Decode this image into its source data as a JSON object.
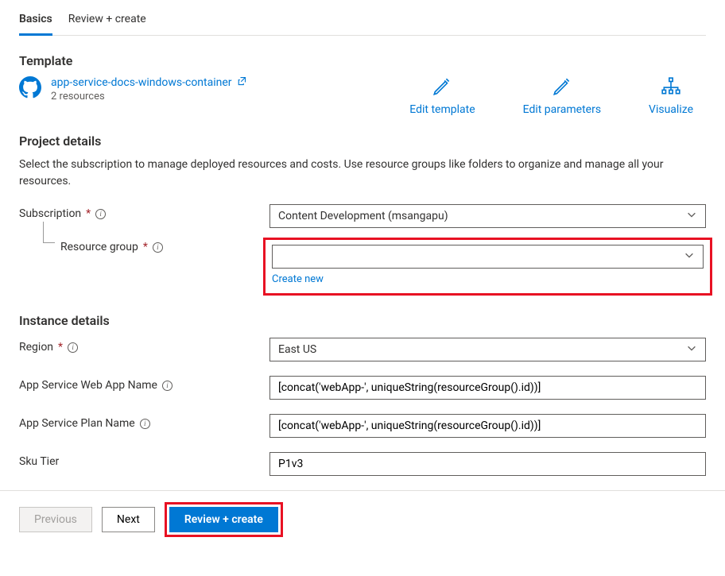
{
  "tabs": {
    "basics": "Basics",
    "review": "Review + create"
  },
  "template": {
    "heading": "Template",
    "link_text": "app-service-docs-windows-container",
    "sub_text": "2 resources"
  },
  "actions": {
    "edit_template": "Edit template",
    "edit_parameters": "Edit parameters",
    "visualize": "Visualize"
  },
  "project": {
    "heading": "Project details",
    "desc": "Select the subscription to manage deployed resources and costs. Use resource groups like folders to organize and manage all your resources.",
    "subscription_label": "Subscription",
    "subscription_value": "Content Development (msangapu)",
    "resource_group_label": "Resource group",
    "resource_group_value": "",
    "create_new": "Create new"
  },
  "instance": {
    "heading": "Instance details",
    "region_label": "Region",
    "region_value": "East US",
    "webapp_label": "App Service Web App Name",
    "webapp_value": "[concat('webApp-', uniqueString(resourceGroup().id))]",
    "plan_label": "App Service Plan Name",
    "plan_value": "[concat('webApp-', uniqueString(resourceGroup().id))]",
    "sku_label": "Sku Tier",
    "sku_value": "P1v3"
  },
  "buttons": {
    "previous": "Previous",
    "next": "Next",
    "review_create": "Review + create"
  }
}
